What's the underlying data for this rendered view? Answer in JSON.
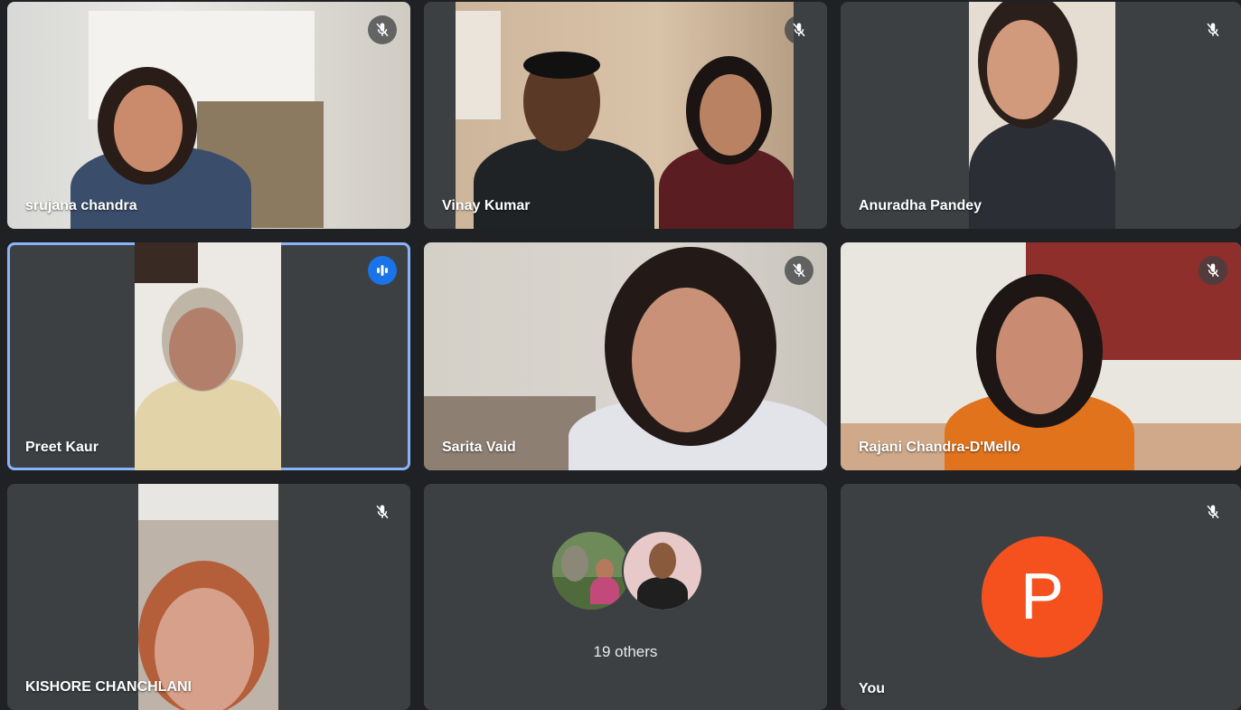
{
  "tiles": [
    {
      "name": "srujana chandra"
    },
    {
      "name": "Vinay Kumar"
    },
    {
      "name": "Anuradha Pandey"
    },
    {
      "name": "Preet Kaur"
    },
    {
      "name": "Sarita Vaid"
    },
    {
      "name": "Rajani Chandra-D'Mello"
    },
    {
      "name": "KISHORE CHANCHLANI"
    }
  ],
  "others": {
    "label": "19 others"
  },
  "self": {
    "name": "You",
    "initial": "P",
    "avatar_color": "#f4511e"
  },
  "colors": {
    "background": "#202124",
    "tile": "#3c4043",
    "speaking_outline": "#8ab4f8",
    "speaking_badge": "#1a73e8"
  },
  "icons": {
    "muted": "mic-off-icon",
    "speaking": "audio-level-icon"
  }
}
